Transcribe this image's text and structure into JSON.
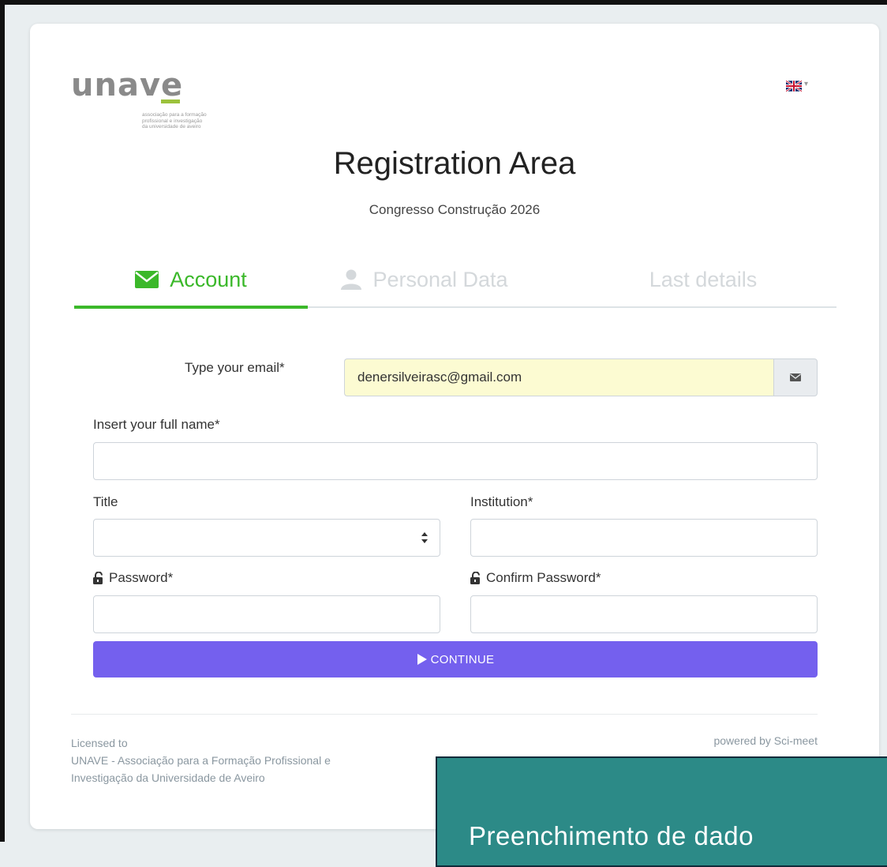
{
  "logo": {
    "word": "unave",
    "tagline_lines": [
      "associação para a formação",
      "profissional e investigação",
      "da universidade de aveiro"
    ]
  },
  "language": {
    "icon": "uk-flag-icon",
    "dropdown_icon": "caret-down-icon"
  },
  "page": {
    "title": "Registration Area",
    "subtitle": "Congresso Construção 2026"
  },
  "tabs": [
    {
      "label": "Account",
      "icon": "envelope-icon",
      "active": true
    },
    {
      "label": "Personal Data",
      "icon": "user-icon",
      "active": false
    },
    {
      "label": "Last details",
      "icon": "",
      "active": false
    }
  ],
  "form": {
    "email": {
      "label": "Type your email*",
      "value": "denersilveirasc@gmail.com",
      "addon_icon": "envelope-icon"
    },
    "full_name": {
      "label": "Insert your full name*",
      "value": ""
    },
    "title": {
      "label": "Title",
      "value": ""
    },
    "institution": {
      "label": "Institution*",
      "value": ""
    },
    "password": {
      "label": "Password*",
      "value": "",
      "icon": "unlock-icon"
    },
    "confirm_password": {
      "label": "Confirm Password*",
      "value": "",
      "icon": "unlock-icon"
    },
    "continue_label": "CONTINUE"
  },
  "footer": {
    "licensed_label": "Licensed to",
    "licensee_line1": "UNAVE - Associação para a Formação Profissional e",
    "licensee_line2": "Investigação da Universidade de Aveiro",
    "powered_by": "powered by Sci-meet"
  },
  "overlay": {
    "text": "Preenchimento de dado"
  },
  "colors": {
    "accent_green": "#3bb82a",
    "button_purple": "#7460ee",
    "overlay_teal": "#2c8a87",
    "autofill_yellow": "#fcfbd2"
  }
}
